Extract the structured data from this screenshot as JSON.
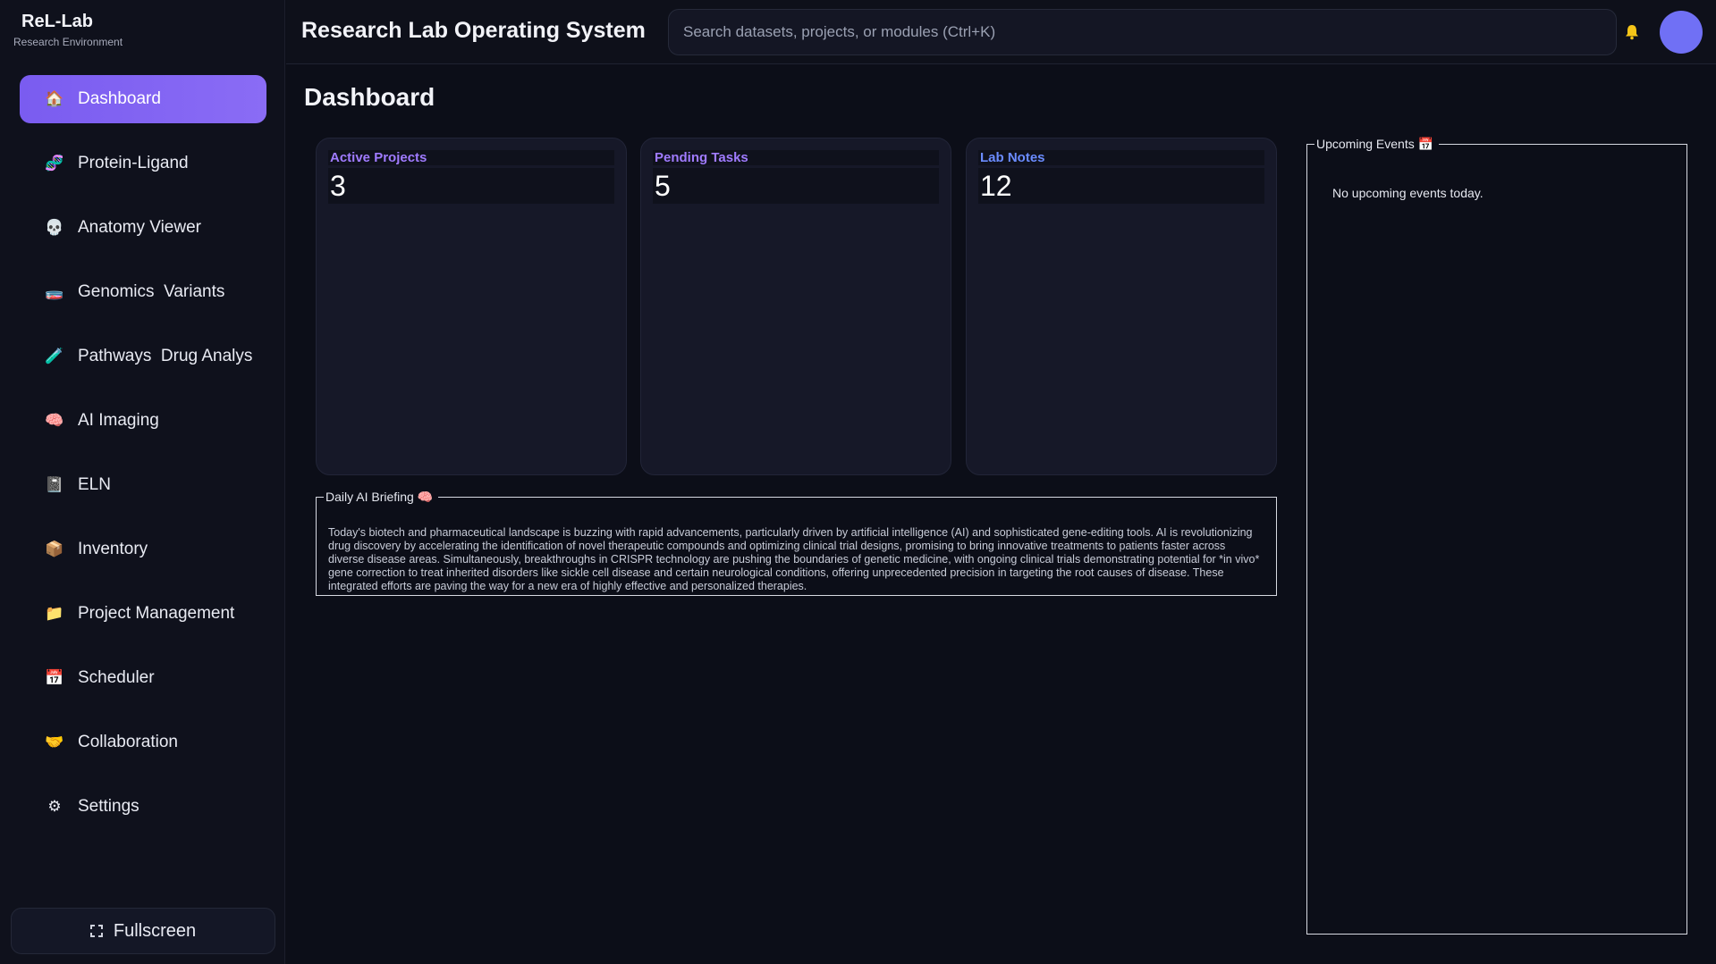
{
  "brand": {
    "title": "ReL-Lab",
    "subtitle": "Research Environment"
  },
  "sidebar": {
    "items": [
      {
        "label": "Dashboard",
        "icon": "house-icon",
        "glyph": "🏠",
        "active": true
      },
      {
        "label": "Protein-Ligand",
        "icon": "molecule-icon",
        "glyph": "🧬",
        "active": false
      },
      {
        "label": "Anatomy Viewer",
        "icon": "skull-icon",
        "glyph": "💀",
        "active": false
      },
      {
        "label": "Genomics  Variants",
        "icon": "globe-icon",
        "glyph": "🧫",
        "active": false
      },
      {
        "label": "Pathways  Drug Analys",
        "icon": "test-tube-icon",
        "glyph": "🧪",
        "active": false
      },
      {
        "label": "AI Imaging",
        "icon": "brain-icon",
        "glyph": "🧠",
        "active": false
      },
      {
        "label": "ELN",
        "icon": "notebook-icon",
        "glyph": "📓",
        "active": false
      },
      {
        "label": "Inventory",
        "icon": "package-icon",
        "glyph": "📦",
        "active": false
      },
      {
        "label": "Project Management",
        "icon": "folder-icon",
        "glyph": "📁",
        "active": false
      },
      {
        "label": "Scheduler",
        "icon": "calendar-icon",
        "glyph": "📅",
        "active": false
      },
      {
        "label": "Collaboration",
        "icon": "handshake-icon",
        "glyph": "🤝",
        "active": false
      },
      {
        "label": "Settings",
        "icon": "gear-icon",
        "glyph": "⚙",
        "active": false
      }
    ],
    "fullscreen_label": "Fullscreen"
  },
  "header": {
    "title": "Research Lab Operating System",
    "search_placeholder": "Search datasets, projects, or modules (Ctrl+K)"
  },
  "main": {
    "page_title": "Dashboard",
    "stats": [
      {
        "label": "Active Projects",
        "value": "3"
      },
      {
        "label": "Pending Tasks",
        "value": "5"
      },
      {
        "label": "Lab Notes",
        "value": "12"
      }
    ],
    "briefing": {
      "legend": "Daily AI Briefing",
      "legend_icon": "🧠",
      "text": "Today's biotech and pharmaceutical landscape is buzzing with rapid advancements, particularly driven by artificial intelligence (AI) and sophisticated gene-editing tools. AI is revolutionizing drug discovery by accelerating the identification of novel therapeutic compounds and optimizing clinical trial designs, promising to bring innovative treatments to patients faster across diverse disease areas. Simultaneously, breakthroughs in CRISPR technology are pushing the boundaries of genetic medicine, with ongoing clinical trials demonstrating potential for *in vivo* gene correction to treat inherited disorders like sickle cell disease and certain neurological conditions, offering unprecedented precision in targeting the root causes of disease. These integrated efforts are paving the way for a new era of highly effective and personalized therapies."
    },
    "events": {
      "legend": "Upcoming Events",
      "legend_icon": "📅",
      "empty_text": "No upcoming events today."
    }
  },
  "colors": {
    "accent": "#7a5cf0",
    "stat_label_purple": "#a07bff",
    "stat_label_blue": "#6b8cff",
    "avatar": "#7070f5",
    "bell": "#f5c518"
  }
}
